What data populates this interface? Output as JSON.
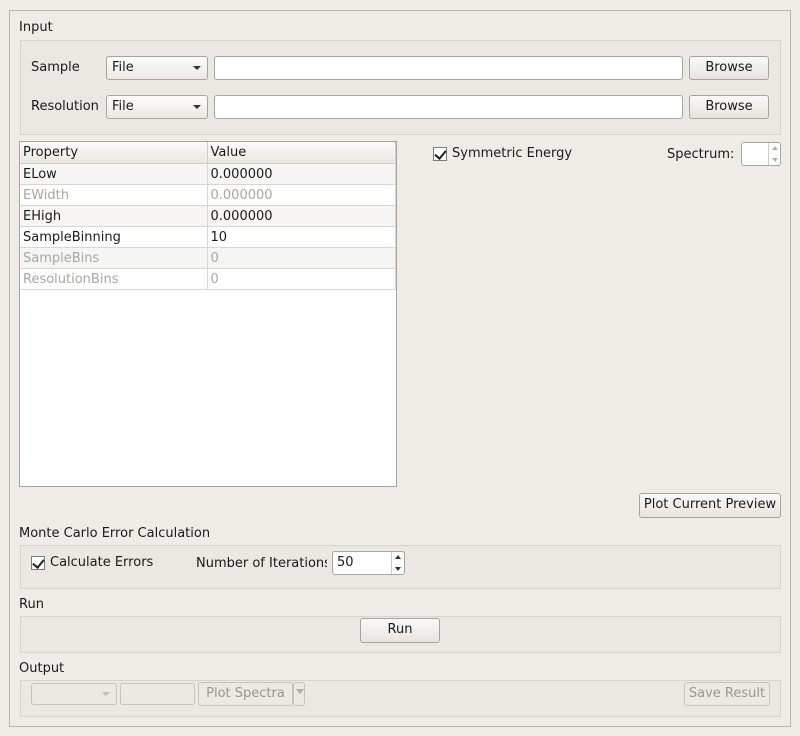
{
  "input": {
    "title": "Input",
    "sample": {
      "label": "Sample",
      "source": "File",
      "path": "",
      "browse": "Browse"
    },
    "resolution": {
      "label": "Resolution",
      "source": "File",
      "path": "",
      "browse": "Browse"
    }
  },
  "properties": {
    "headers": [
      "Property",
      "Value"
    ],
    "rows": [
      {
        "name": "ELow",
        "value": "0.000000",
        "enabled": true
      },
      {
        "name": "EWidth",
        "value": "0.000000",
        "enabled": false
      },
      {
        "name": "EHigh",
        "value": "0.000000",
        "enabled": true
      },
      {
        "name": "SampleBinning",
        "value": "10",
        "enabled": true
      },
      {
        "name": "SampleBins",
        "value": "0",
        "enabled": false
      },
      {
        "name": "ResolutionBins",
        "value": "0",
        "enabled": false
      }
    ]
  },
  "options": {
    "symmetric_energy": {
      "label": "Symmetric Energy",
      "checked": true
    },
    "spectrum": {
      "label": "Spectrum:",
      "value": ""
    }
  },
  "preview": {
    "plot_current_preview": "Plot Current Preview"
  },
  "monte_carlo": {
    "title": "Monte Carlo Error Calculation",
    "calculate_errors": {
      "label": "Calculate Errors",
      "checked": true
    },
    "iterations": {
      "label": "Number of Iterations",
      "value": "50"
    }
  },
  "run": {
    "title": "Run",
    "button": "Run"
  },
  "output": {
    "title": "Output",
    "combo_value": "",
    "field_value": "",
    "plot_spectra": "Plot Spectra",
    "save_result": "Save Result"
  }
}
